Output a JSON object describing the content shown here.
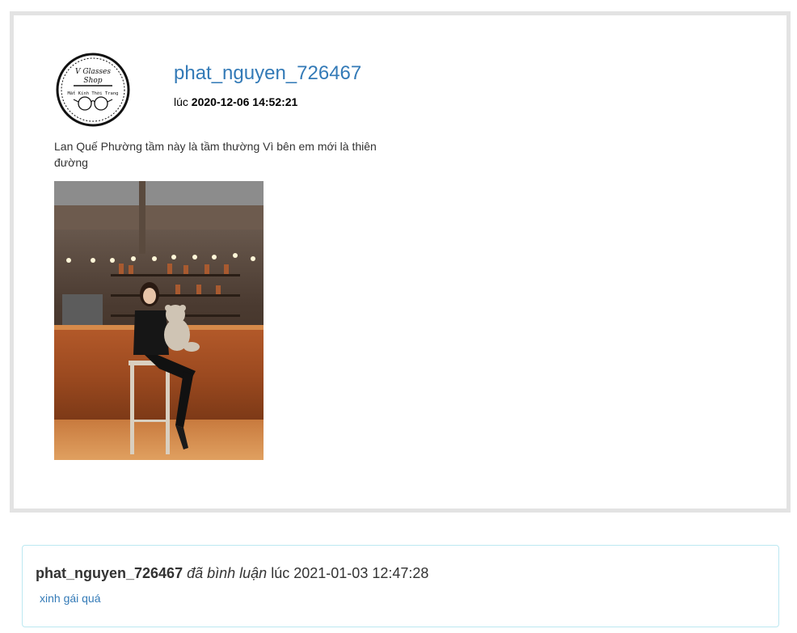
{
  "post": {
    "username": "phat_nguyen_726467",
    "time_prefix": "lúc",
    "timestamp": "2020-12-06 14:52:21",
    "text": "Lan Quế Phường tầm này là tầm thường Vì bên em mới là thiên đường",
    "avatar": {
      "icon": "glasses-shop-logo-icon",
      "line1": "V Glasses",
      "line2": "Shop",
      "line3": "Mắt Kính Thời Trang"
    },
    "photo": {
      "icon": "photo-girl-with-teddy-bear-icon"
    }
  },
  "comment": {
    "username": "phat_nguyen_726467",
    "verb": "đã bình luận",
    "time_prefix": "lúc",
    "timestamp": "2021-01-03 12:47:28",
    "text": "xinh gái quá"
  },
  "colors": {
    "link": "#337ab7",
    "card_border": "#e3e3e3",
    "comment_border": "#bce8f1"
  }
}
